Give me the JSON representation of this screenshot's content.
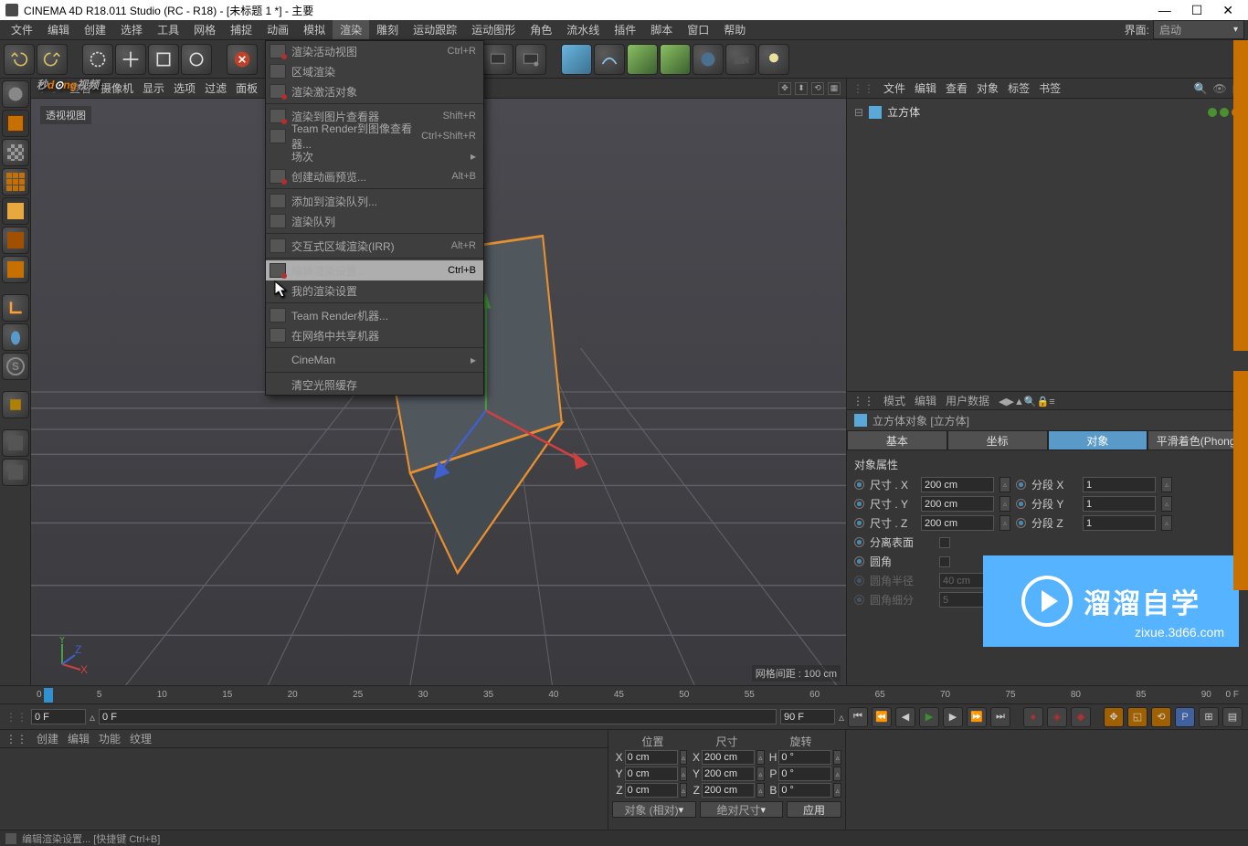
{
  "titlebar": {
    "title": "CINEMA 4D R18.011 Studio (RC - R18) - [未标题 1 *] - 主要"
  },
  "menubar": {
    "items": [
      "文件",
      "编辑",
      "创建",
      "选择",
      "工具",
      "网格",
      "捕捉",
      "动画",
      "模拟",
      "渲染",
      "雕刻",
      "运动跟踪",
      "运动图形",
      "角色",
      "流水线",
      "插件",
      "脚本",
      "窗口",
      "帮助"
    ],
    "layout_label": "界面:",
    "layout_value": "启动"
  },
  "render_menu": {
    "items": [
      {
        "label": "渲染活动视图",
        "shortcut": "Ctrl+R"
      },
      {
        "label": "区域渲染"
      },
      {
        "label": "渲染激活对象"
      },
      {
        "sep": true
      },
      {
        "label": "渲染到图片查看器",
        "shortcut": "Shift+R"
      },
      {
        "label": "Team Render到图像查看器...",
        "shortcut": "Ctrl+Shift+R"
      },
      {
        "label": "场次",
        "submenu": true
      },
      {
        "label": "创建动画预览...",
        "shortcut": "Alt+B"
      },
      {
        "sep": true
      },
      {
        "label": "添加到渲染队列..."
      },
      {
        "label": "渲染队列"
      },
      {
        "sep": true
      },
      {
        "label": "交互式区域渲染(IRR)",
        "shortcut": "Alt+R"
      },
      {
        "sep": true
      },
      {
        "label": "编辑渲染设置...",
        "shortcut": "Ctrl+B",
        "hover": true
      },
      {
        "label": "我的渲染设置",
        "check": true
      },
      {
        "sep": true
      },
      {
        "label": "Team Render机器..."
      },
      {
        "label": "在网络中共享机器",
        "disabled": true
      },
      {
        "sep": true
      },
      {
        "label": "CineMan",
        "submenu": true
      },
      {
        "sep": true
      },
      {
        "label": "清空光照缓存"
      }
    ]
  },
  "viewtabs": [
    "查看",
    "摄像机",
    "显示",
    "选项",
    "过滤",
    "面板"
  ],
  "viewport": {
    "name": "透视视图",
    "grid_label": "网格间距 : 100 cm"
  },
  "watermark": {
    "t1": "秒",
    "t2": "d",
    "t3": "ng",
    "t4": "视频"
  },
  "brand": {
    "main": "溜溜自学",
    "sub": "zixue.3d66.com"
  },
  "obj_panel": {
    "tabs": [
      "文件",
      "编辑",
      "查看",
      "对象",
      "标签",
      "书签"
    ],
    "tree": [
      {
        "name": "立方体"
      }
    ]
  },
  "attr": {
    "tabs": [
      "模式",
      "编辑",
      "用户数据"
    ],
    "title": "立方体对象 [立方体]",
    "subtabs": [
      "基本",
      "坐标",
      "对象",
      "平滑着色(Phong)"
    ],
    "group": "对象属性",
    "rows": [
      {
        "l1": "尺寸 . X",
        "v1": "200 cm",
        "l2": "分段 X",
        "v2": "1"
      },
      {
        "l1": "尺寸 . Y",
        "v1": "200 cm",
        "l2": "分段 Y",
        "v2": "1"
      },
      {
        "l1": "尺寸 . Z",
        "v1": "200 cm",
        "l2": "分段 Z",
        "v2": "1"
      }
    ],
    "sep_surface": "分离表面",
    "fillet": "圆角",
    "fillet_r_lbl": "圆角半径",
    "fillet_r": "40 cm",
    "fillet_s_lbl": "圆角细分",
    "fillet_s": "5"
  },
  "timeline": {
    "ticks": [
      "0",
      "5",
      "10",
      "15",
      "20",
      "25",
      "30",
      "35",
      "40",
      "45",
      "50",
      "55",
      "60",
      "65",
      "70",
      "75",
      "80",
      "85",
      "90"
    ],
    "unit": "0 F"
  },
  "playbar": {
    "start": "0 F",
    "cur": "0 F",
    "end": "90 F"
  },
  "mat_tabs": [
    "创建",
    "编辑",
    "功能",
    "纹理"
  ],
  "coord": {
    "hdr": [
      "位置",
      "尺寸",
      "旋转"
    ],
    "rows": [
      {
        "ax": "X",
        "p": "0 cm",
        "s": "200 cm",
        "rax": "H",
        "r": "0 °"
      },
      {
        "ax": "Y",
        "p": "0 cm",
        "s": "200 cm",
        "rax": "P",
        "r": "0 °"
      },
      {
        "ax": "Z",
        "p": "0 cm",
        "s": "200 cm",
        "rax": "B",
        "r": "0 °"
      }
    ],
    "dd1": "对象 (相对)",
    "dd2": "绝对尺寸",
    "apply": "应用"
  },
  "status": "编辑渲染设置... [快捷键 Ctrl+B]"
}
